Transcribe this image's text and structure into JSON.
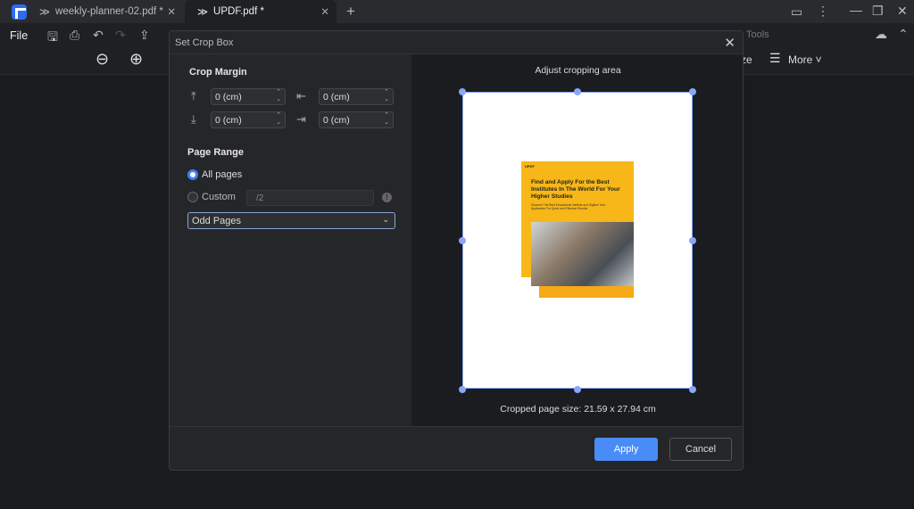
{
  "tabs": [
    {
      "label": "weekly-planner-02.pdf *"
    },
    {
      "label": "UPDF.pdf *"
    }
  ],
  "toolbar": {
    "file": "File",
    "tools": "Tools",
    "ize": "ze",
    "more": "More"
  },
  "dialog": {
    "title": "Set Crop Box",
    "crop_margin": "Crop Margin",
    "top": "0 (cm)",
    "bottom": "0 (cm)",
    "left": "0 (cm)",
    "right": "0 (cm)",
    "page_range": "Page Range",
    "all_pages": "All pages",
    "custom": "Custom",
    "custom_value": "/2",
    "subset": "Odd Pages",
    "adjust": "Adjust cropping area",
    "size": "Cropped page size: 21.59 x 27.94 cm",
    "apply": "Apply",
    "cancel": "Cancel"
  },
  "doc": {
    "title": "Find and Apply For the Best Institutes In The World For Your Higher Studies",
    "sub": "Discover The Best Educational Institute and Digitize Your Application For Quick and Effective Results",
    "brand": "UPDF"
  },
  "colors": {
    "accent": "#4a8cf7",
    "doc_yellow": "#f7b718"
  }
}
